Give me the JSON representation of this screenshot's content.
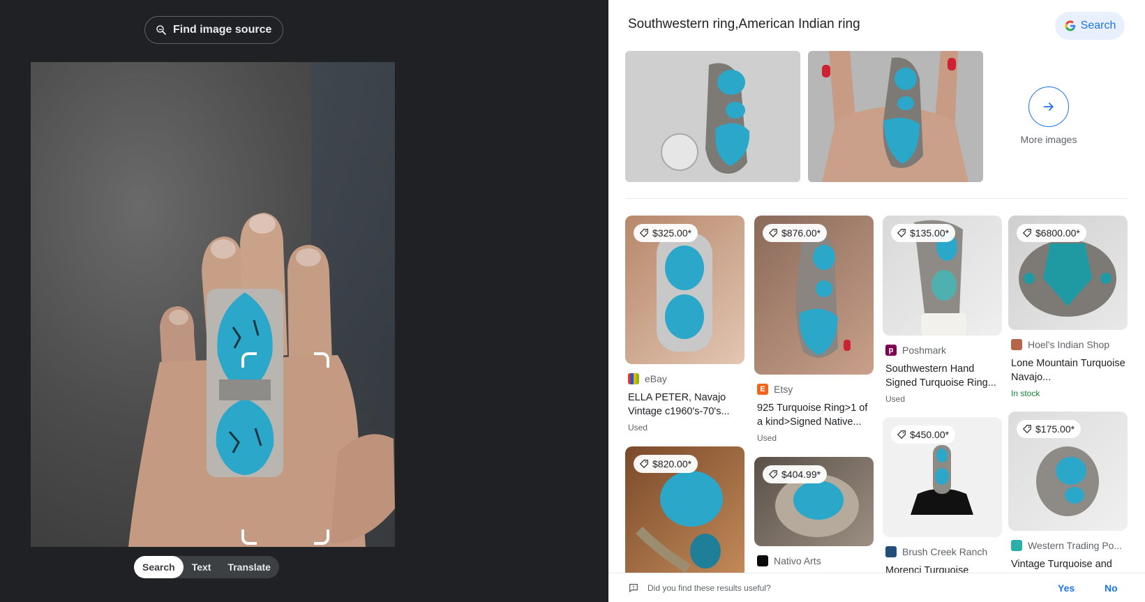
{
  "left": {
    "find_source_label": "Find image source",
    "modes": [
      "Search",
      "Text",
      "Translate"
    ],
    "active_mode": "Search"
  },
  "right": {
    "header_title": "Southwestern ring,American Indian ring",
    "search_button_label": "Search",
    "more_images_label": "More images",
    "results": [
      {
        "price": "$325.00*",
        "source": "eBay",
        "title": "ELLA PETER, Navajo Vintage c1960's-70's...",
        "condition": "Used",
        "favicon_color": "#e53238"
      },
      {
        "price": "$876.00*",
        "source": "Etsy",
        "title": "925 Turquoise Ring>1 of a kind>Signed Native...",
        "condition": "Used",
        "favicon_color": "#f1641e"
      },
      {
        "price": "$135.00*",
        "source": "Poshmark",
        "title": "Southwestern Hand Signed Turquoise Ring...",
        "condition": "Used",
        "favicon_color": "#7f0353"
      },
      {
        "price": "$6800.00*",
        "source": "Hoel's Indian Shop",
        "title": "Lone Mountain Turquoise Navajo...",
        "condition": "In stock",
        "favicon_color": "#b5654a"
      },
      {
        "price": "$820.00*",
        "source": "",
        "title": "",
        "condition": "",
        "favicon_color": ""
      },
      {
        "price": "$404.99*",
        "source": "Nativo Arts",
        "title": "",
        "condition": "",
        "favicon_color": "#0a0a0a"
      },
      {
        "price": "$450.00*",
        "source": "Brush Creek Ranch",
        "title": "Morenci Turquoise",
        "condition": "",
        "favicon_color": "#1f4e79"
      },
      {
        "price": "$175.00*",
        "source": "Western Trading Po...",
        "title": "Vintage Turquoise and",
        "condition": "",
        "favicon_color": "#2bb0a8"
      }
    ],
    "feedback": {
      "question": "Did you find these results useful?",
      "yes": "Yes",
      "no": "No"
    }
  },
  "colors": {
    "accent": "#1a73e8",
    "dark_bg": "#202124",
    "turquoise": "#2aa7c9",
    "in_stock": "#188038"
  }
}
